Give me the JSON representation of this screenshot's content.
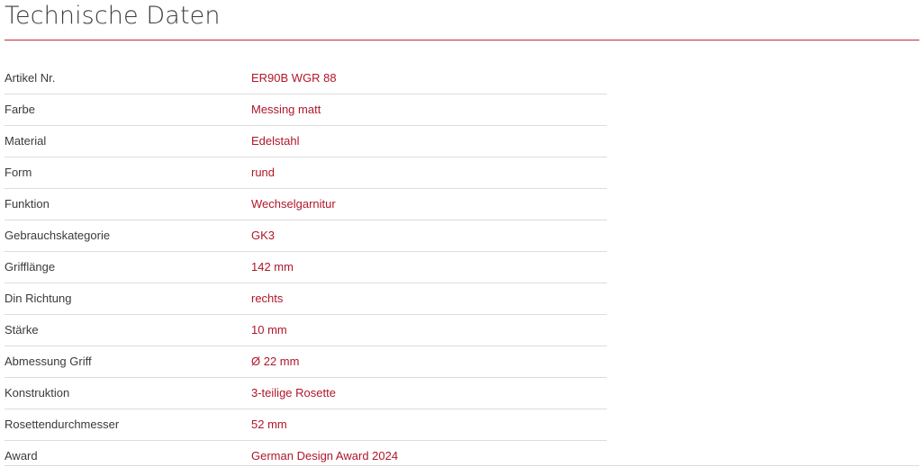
{
  "section": {
    "title": "Technische Daten"
  },
  "specs": [
    {
      "label": "Artikel Nr.",
      "value": "ER90B WGR 88"
    },
    {
      "label": "Farbe",
      "value": "Messing matt"
    },
    {
      "label": "Material",
      "value": "Edelstahl"
    },
    {
      "label": "Form",
      "value": "rund"
    },
    {
      "label": "Funktion",
      "value": "Wechselgarnitur"
    },
    {
      "label": "Gebrauchskategorie",
      "value": "GK3"
    },
    {
      "label": "Grifflänge",
      "value": "142 mm"
    },
    {
      "label": "Din Richtung",
      "value": "rechts"
    },
    {
      "label": "Stärke",
      "value": "10 mm"
    },
    {
      "label": "Abmessung Griff",
      "value": "Ø 22 mm"
    },
    {
      "label": "Konstruktion",
      "value": "3-teilige Rosette"
    },
    {
      "label": "Rosettendurchmesser",
      "value": "52 mm"
    },
    {
      "label": "Award",
      "value": "German Design Award 2024"
    }
  ],
  "colors": {
    "accent": "#c4293a",
    "value_text": "#b0172a",
    "label_text": "#3a3a3a",
    "divider": "#dcdcdc"
  }
}
